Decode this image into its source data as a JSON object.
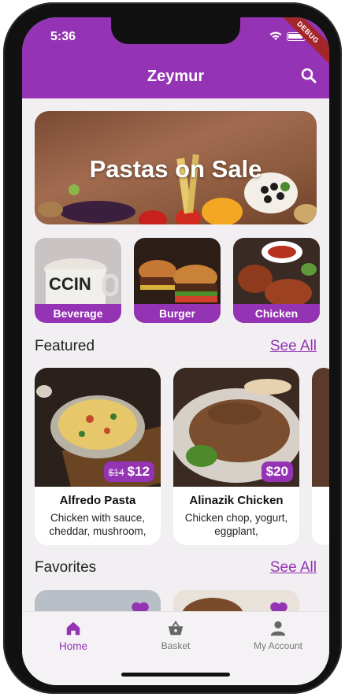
{
  "status_bar": {
    "time": "5:36",
    "debug_label": "DEBUG"
  },
  "app_bar": {
    "title": "Zeymur",
    "search_icon": "search-icon"
  },
  "banner": {
    "text": "Pastas on Sale"
  },
  "categories": [
    {
      "label": "Beverage"
    },
    {
      "label": "Burger"
    },
    {
      "label": "Chicken"
    }
  ],
  "featured": {
    "title": "Featured",
    "see_all": "See All",
    "items": [
      {
        "name": "Alfredo Pasta",
        "description": "Chicken with sauce, cheddar, mushroom,",
        "old_price": "$14",
        "price": "$12"
      },
      {
        "name": "Alinazik Chicken",
        "description": "Chicken chop, yogurt, eggplant,",
        "price": "$20"
      }
    ]
  },
  "favorites": {
    "title": "Favorites",
    "see_all": "See All"
  },
  "bottom_nav": [
    {
      "label": "Home",
      "icon": "home-icon",
      "active": true
    },
    {
      "label": "Basket",
      "icon": "basket-icon",
      "active": false
    },
    {
      "label": "My Account",
      "icon": "person-icon",
      "active": false
    }
  ],
  "colors": {
    "primary": "#9433b4",
    "background": "#f1eff1"
  }
}
